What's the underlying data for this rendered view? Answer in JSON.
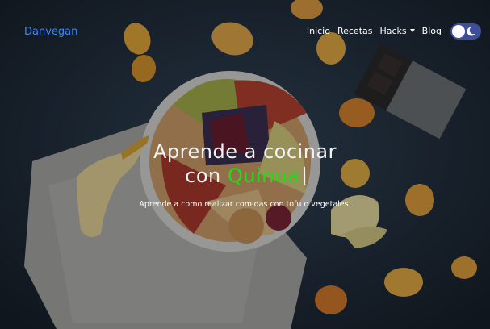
{
  "brand": {
    "name": "Danvegan"
  },
  "nav": {
    "items": [
      {
        "label": "Inicio"
      },
      {
        "label": "Recetas"
      },
      {
        "label": "Hacks"
      },
      {
        "label": "Blog"
      }
    ]
  },
  "hero": {
    "title_line1": "Aprende a cocinar",
    "title_prefix": "con",
    "highlight": "Quinua",
    "subtitle": "Aprende a como realizar comidas con tofu o vegetales."
  },
  "colors": {
    "brand": "#3a86ff",
    "highlight": "#22dd11",
    "toggle": "#3f4e99"
  },
  "icons": {
    "theme_toggle": "moon-icon",
    "hacks_dropdown": "caret-down-icon"
  }
}
